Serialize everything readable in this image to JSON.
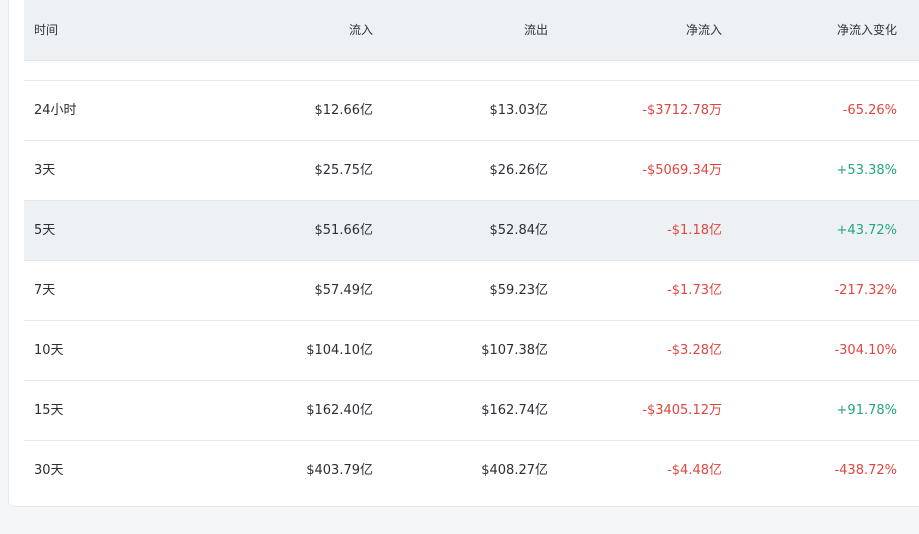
{
  "table": {
    "headers": [
      "时间",
      "流入",
      "流出",
      "净流入",
      "净流入变化"
    ],
    "rows": [
      {
        "period": "24小时",
        "inflow": "$12.66亿",
        "outflow": "$13.03亿",
        "net": "-$3712.78万",
        "change": "-65.26%"
      },
      {
        "period": "3天",
        "inflow": "$25.75亿",
        "outflow": "$26.26亿",
        "net": "-$5069.34万",
        "change": "+53.38%"
      },
      {
        "period": "5天",
        "inflow": "$51.66亿",
        "outflow": "$52.84亿",
        "net": "-$1.18亿",
        "change": "+43.72%"
      },
      {
        "period": "7天",
        "inflow": "$57.49亿",
        "outflow": "$59.23亿",
        "net": "-$1.73亿",
        "change": "-217.32%"
      },
      {
        "period": "10天",
        "inflow": "$104.10亿",
        "outflow": "$107.38亿",
        "net": "-$3.28亿",
        "change": "-304.10%"
      },
      {
        "period": "15天",
        "inflow": "$162.40亿",
        "outflow": "$162.74亿",
        "net": "-$3405.12万",
        "change": "+91.78%"
      },
      {
        "period": "30天",
        "inflow": "$403.79亿",
        "outflow": "$408.27亿",
        "net": "-$4.48亿",
        "change": "-438.72%"
      }
    ]
  },
  "colors": {
    "negative": "#e0463f",
    "positive": "#22a680",
    "header_bg": "#eef1f4",
    "row_highlight": "#eef1f4"
  }
}
